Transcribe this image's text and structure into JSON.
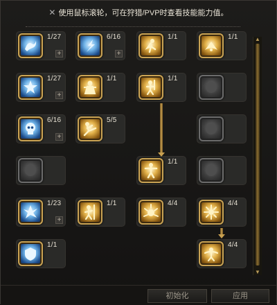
{
  "header": {
    "close_glyph": "✕",
    "notice": "使用鼠标滚轮，可在狩猎/PVP时查看技能能力值。"
  },
  "skills": {
    "r1c1": {
      "count": "1/27",
      "icon": "water-dragon-icon"
    },
    "r1c2": {
      "count": "6/16",
      "icon": "blue-dash-figure-icon"
    },
    "r1c3": {
      "count": "1/1",
      "icon": "golden-leap-icon"
    },
    "r1c4": {
      "count": "1/1",
      "icon": "golden-fan-icon"
    },
    "r2c1": {
      "count": "1/27",
      "icon": "blue-star-burst-icon"
    },
    "r2c2": {
      "count": "1/1",
      "icon": "golden-monk-icon"
    },
    "r2c3": {
      "count": "1/1",
      "icon": "golden-sword-figure-icon"
    },
    "r2c4": {
      "count": "",
      "icon": "locked-skill-icon"
    },
    "r3c1": {
      "count": "6/16",
      "icon": "blue-skull-icon"
    },
    "r3c2": {
      "count": "5/5",
      "icon": "golden-kick-icon"
    },
    "r3c4": {
      "count": "",
      "icon": "locked-skill-icon"
    },
    "r4c1": {
      "count": "",
      "icon": "locked-skill-icon"
    },
    "r4c3": {
      "count": "1/1",
      "icon": "golden-standing-figure-icon"
    },
    "r4c4": {
      "count": "",
      "icon": "locked-skill-icon"
    },
    "r5c1": {
      "count": "1/23",
      "icon": "blue-shatter-icon"
    },
    "r5c2": {
      "count": "1/1",
      "icon": "golden-spear-figure-icon"
    },
    "r5c3": {
      "count": "4/4",
      "icon": "golden-radiance-icon"
    },
    "r5c4": {
      "count": "4/4",
      "icon": "golden-flare-icon"
    },
    "r6c1": {
      "count": "1/1",
      "icon": "blue-shield-icon"
    },
    "r6c4": {
      "count": "4/4",
      "icon": "golden-aura-icon"
    }
  },
  "plus_glyph": "+",
  "scroll": {
    "up": "▲",
    "down": "▼"
  },
  "footer": {
    "reset_label": "初始化",
    "apply_label": "应用"
  }
}
